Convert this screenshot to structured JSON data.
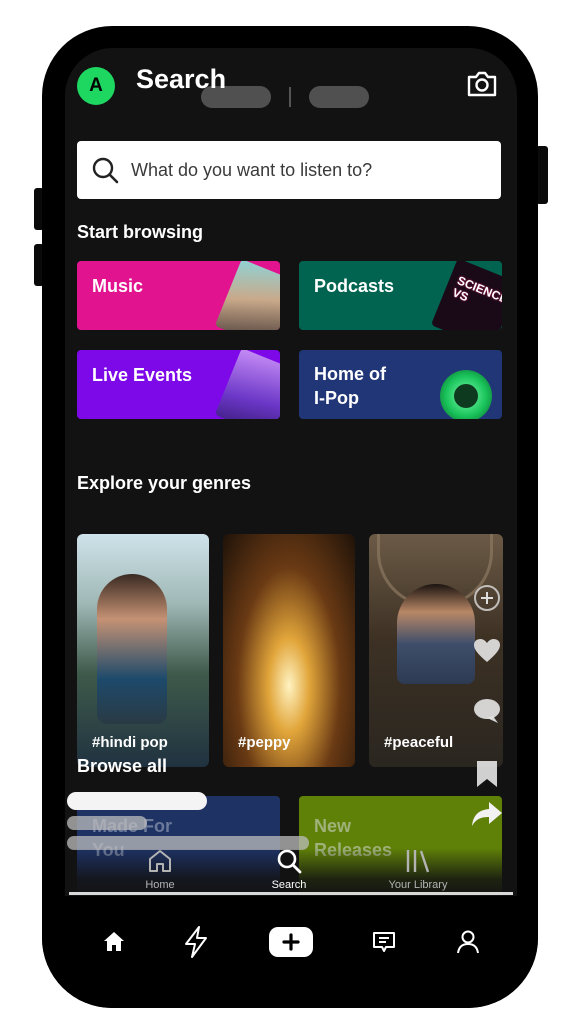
{
  "header": {
    "avatar_letter": "A",
    "title": "Search"
  },
  "search": {
    "placeholder": "What do you want to listen to?"
  },
  "start_browsing": {
    "heading": "Start browsing",
    "tiles": [
      {
        "label": "Music",
        "color": "#e1138f"
      },
      {
        "label": "Podcasts",
        "color": "#006450"
      },
      {
        "label": "Live Events",
        "color": "#7d08e8"
      },
      {
        "label": "Home of\nI-Pop",
        "color": "#213677"
      }
    ],
    "podcast_art_text": "SCIENCE VS"
  },
  "genres": {
    "heading": "Explore your genres",
    "items": [
      {
        "label": "#hindi pop"
      },
      {
        "label": "#peppy"
      },
      {
        "label": "#peaceful"
      }
    ]
  },
  "browse_all": {
    "heading": "Browse all",
    "tiles": [
      {
        "label": "Made For\nYou",
        "color": "#1e3264"
      },
      {
        "label": "New\nReleases",
        "color": "#608108"
      }
    ]
  },
  "bottom_nav": {
    "items": [
      {
        "label": "Home",
        "icon": "home-outline-icon"
      },
      {
        "label": "Search",
        "icon": "search-icon",
        "active": true
      },
      {
        "label": "Your Library",
        "icon": "library-icon"
      }
    ]
  },
  "system_bar": {
    "icons": [
      "home-icon",
      "lightning-icon",
      "plus-icon",
      "message-icon",
      "profile-icon"
    ]
  },
  "colors": {
    "accent": "#1ed760",
    "background": "#121212"
  }
}
